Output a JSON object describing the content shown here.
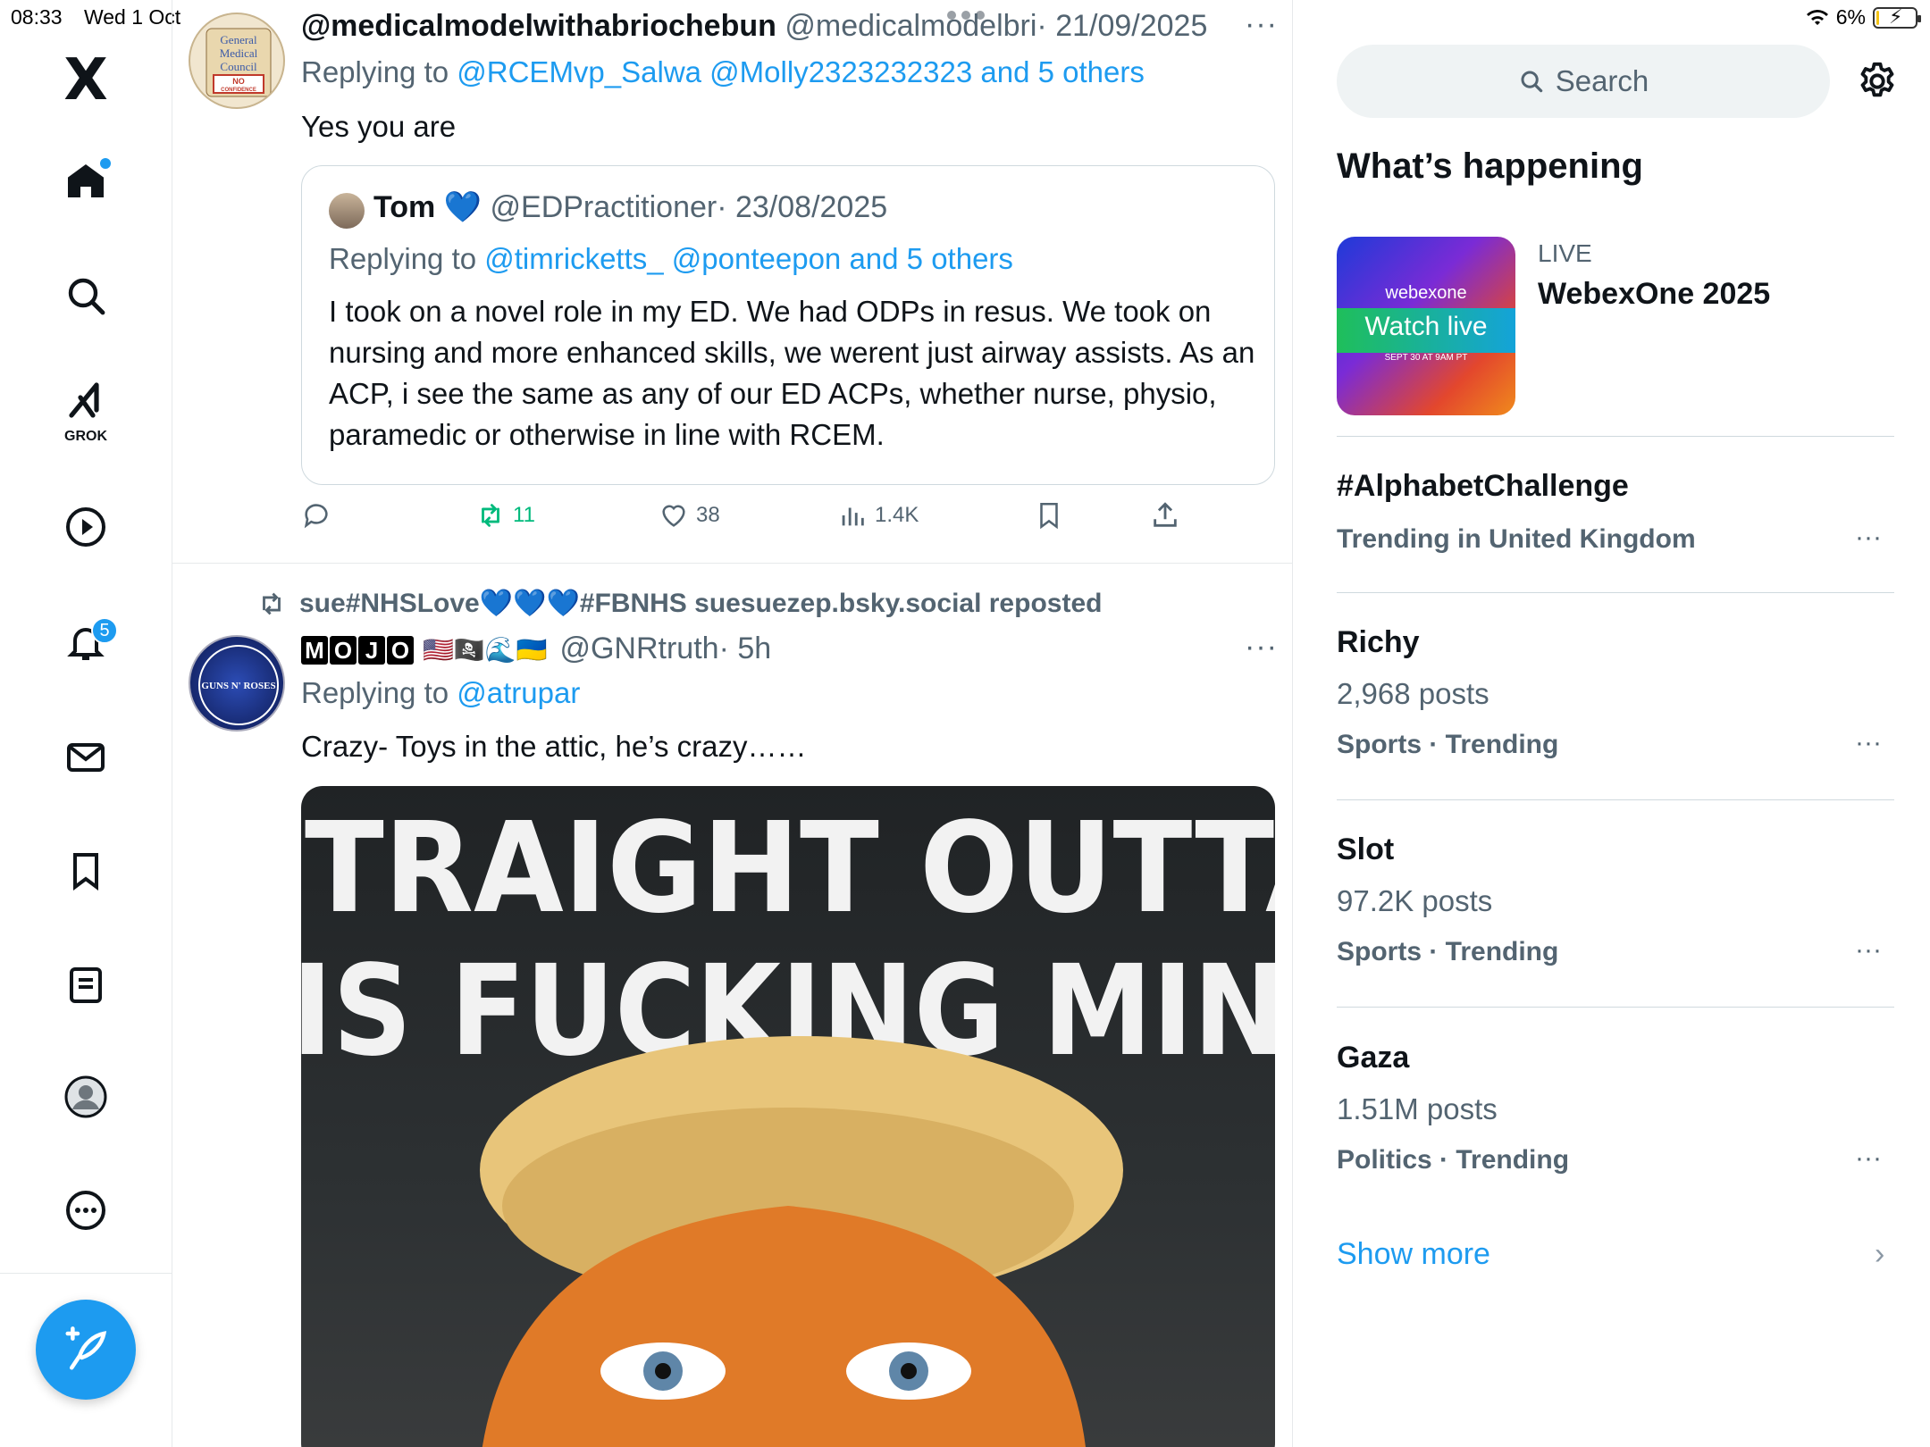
{
  "status": {
    "time": "08:33",
    "date": "Wed 1 Oct",
    "battery": "6%",
    "battery_level": 0.06
  },
  "nav": {
    "logo": "X",
    "grok_label": "GROK",
    "notifications_badge": "5",
    "items": [
      "home-icon",
      "search-icon",
      "grok-icon",
      "video-icon",
      "notifications-icon",
      "messages-icon",
      "bookmarks-icon",
      "lists-icon",
      "profile-icon",
      "more-icon"
    ]
  },
  "tweet1": {
    "name": "@medicalmodelwithabriochebun",
    "handle": "@medicalmodelbri",
    "date": "· 21/09/2025",
    "reply_prefix": "Replying to ",
    "reply_links": "@RCEMvp_Salwa @Molly2323232323 and 5 others",
    "text": "Yes you are",
    "quote": {
      "name": "Tom",
      "emoji": "💙",
      "handle": "@EDPractitioner",
      "date": "· 23/08/2025",
      "reply_prefix": "Replying to ",
      "reply_links": "@timricketts_ @ponteepon and 5 others",
      "body": "I took on a novel role in my ED. We had ODPs in resus. We took on nursing and more enhanced skills, we werent just airway assists. As an ACP, i see the same as any of our ED ACPs, whether nurse, physio, paramedic or otherwise in line with RCEM."
    },
    "avatar_text": [
      "General",
      "Medical",
      "Council",
      "NO",
      "CONFIDENCE"
    ],
    "actions": {
      "retweets": "11",
      "likes": "38",
      "views": "1.4K"
    }
  },
  "tweet2": {
    "repost_text": "sue#NHSLove💙💙💙#FBNHS suesuezep.bsky.social reposted",
    "name_letters": [
      "M",
      "O",
      "J",
      "O"
    ],
    "flags": "🇺🇸🏴‍☠️🌊🇺🇦",
    "handle": "@GNRtruth",
    "time": "· 5h",
    "reply_prefix": "Replying to ",
    "reply_links": "@atrupar",
    "text": "Crazy- Toys in the attic, he’s crazy……",
    "avatar_text": "GUNS N' ROSES",
    "image_line1": "STRAIGHT OUTTA",
    "image_line2": "HIS FUCKING MIND"
  },
  "sidebar": {
    "search_placeholder": "Search",
    "section_title": "What’s happening",
    "live": {
      "tag": "LIVE",
      "title": "WebexOne 2025",
      "thumb_brand": "webexone",
      "thumb_cta": "Watch live",
      "thumb_date": "SEPT 30 AT 9AM PT"
    },
    "trends": [
      {
        "name": "#AlphabetChallenge",
        "posts": "",
        "context": "Trending in United Kingdom"
      },
      {
        "name": "Richy",
        "posts": "2,968 posts",
        "context": "Sports · Trending"
      },
      {
        "name": "Slot",
        "posts": "97.2K posts",
        "context": "Sports · Trending"
      },
      {
        "name": "Gaza",
        "posts": "1.51M posts",
        "context": "Politics · Trending"
      }
    ],
    "show_more": "Show more"
  },
  "colors": {
    "accent": "#1d9bf0",
    "retweet_green": "#00ba7c",
    "muted": "#536471"
  }
}
